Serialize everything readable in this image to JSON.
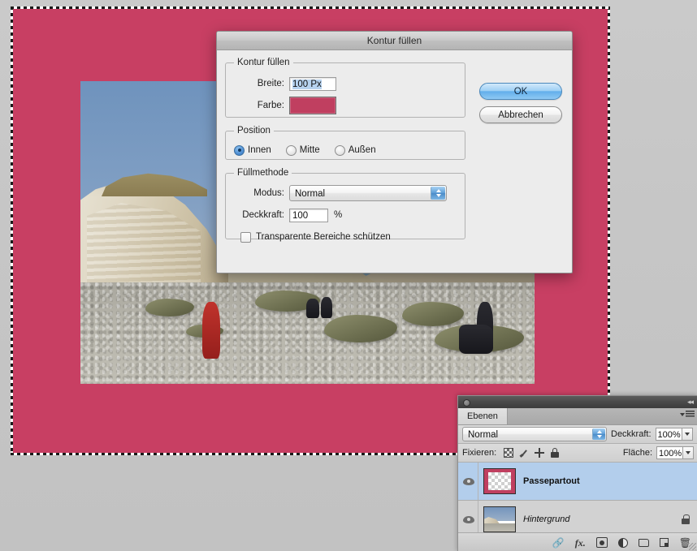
{
  "app": {
    "canvas_color": "#c83f63",
    "accent_blue": "#62aeeb"
  },
  "dialog": {
    "title": "Kontur füllen",
    "groups": {
      "stroke": {
        "legend": "Kontur füllen",
        "width_label": "Breite:",
        "width_value": "100 Px",
        "color_label": "Farbe:",
        "color_value": "#c03f60"
      },
      "position": {
        "legend": "Position",
        "options": [
          {
            "label": "Innen",
            "selected": true
          },
          {
            "label": "Mitte",
            "selected": false
          },
          {
            "label": "Außen",
            "selected": false
          }
        ]
      },
      "fill": {
        "legend": "Füllmethode",
        "mode_label": "Modus:",
        "mode_value": "Normal",
        "opacity_label": "Deckkraft:",
        "opacity_value": "100",
        "percent_sign": "%",
        "preserve_label": "Transparente Bereiche schützen",
        "preserve_checked": false
      }
    },
    "buttons": {
      "ok": "OK",
      "cancel": "Abbrechen"
    }
  },
  "panel": {
    "tab_label": "Ebenen",
    "blend": {
      "mode_value": "Normal",
      "opacity_label": "Deckkraft:",
      "opacity_value": "100%"
    },
    "lock": {
      "label": "Fixieren:",
      "fill_label": "Fläche:",
      "fill_value": "100%",
      "icons": [
        "lock-transparency-icon",
        "lock-image-icon",
        "lock-position-icon",
        "lock-all-icon"
      ]
    },
    "layers": [
      {
        "name": "Passepartout",
        "selected": true,
        "italic": false,
        "locked": false,
        "thumb": "transparent-mat"
      },
      {
        "name": "Hintergrund",
        "selected": false,
        "italic": true,
        "locked": true,
        "thumb": "photo"
      }
    ],
    "footer_icons": [
      "link-layers-icon",
      "layer-style-fx-icon",
      "layer-mask-icon",
      "adjustment-layer-icon",
      "new-group-icon",
      "new-layer-icon",
      "delete-layer-icon"
    ]
  }
}
